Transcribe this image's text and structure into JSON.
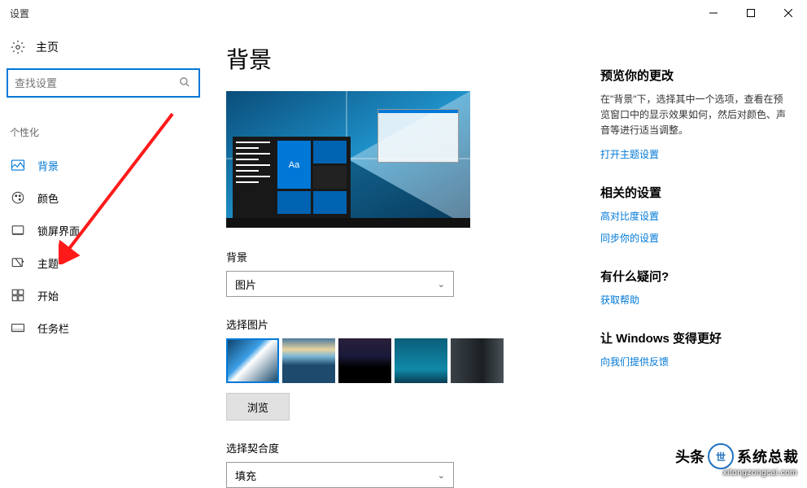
{
  "window": {
    "title": "设置"
  },
  "sidebar": {
    "home": "主页",
    "search_placeholder": "查找设置",
    "category": "个性化",
    "items": [
      {
        "label": "背景"
      },
      {
        "label": "颜色"
      },
      {
        "label": "锁屏界面"
      },
      {
        "label": "主题"
      },
      {
        "label": "开始"
      },
      {
        "label": "任务栏"
      }
    ]
  },
  "main": {
    "title": "背景",
    "preview_tile_text": "Aa",
    "bg_label": "背景",
    "bg_dropdown": "图片",
    "choose_label": "选择图片",
    "browse": "浏览",
    "fit_label": "选择契合度",
    "fit_dropdown": "填充"
  },
  "right": {
    "preview_heading": "预览你的更改",
    "preview_text": "在\"背景\"下，选择其中一个选项，查看在预览窗口中的显示效果如何，然后对颜色、声音等进行适当调整。",
    "theme_link": "打开主题设置",
    "related_heading": "相关的设置",
    "contrast_link": "高对比度设置",
    "sync_link": "同步你的设置",
    "question_heading": "有什么疑问?",
    "help_link": "获取帮助",
    "better_heading": "让 Windows 变得更好",
    "feedback_link": "向我们提供反馈"
  },
  "watermark": {
    "head": "头条",
    "name": "系统总裁",
    "url": "xitongzongcai.com"
  }
}
